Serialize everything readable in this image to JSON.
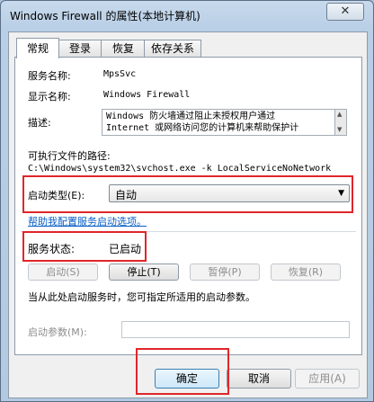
{
  "window": {
    "title": "Windows Firewall 的属性(本地计算机)",
    "close_glyph": "✕"
  },
  "tabs": [
    {
      "label": "常规",
      "active": true
    },
    {
      "label": "登录",
      "active": false
    },
    {
      "label": "恢复",
      "active": false
    },
    {
      "label": "依存关系",
      "active": false
    }
  ],
  "general": {
    "service_name_label": "服务名称:",
    "service_name_value": "MpsSvc",
    "display_name_label": "显示名称:",
    "display_name_value": "Windows Firewall",
    "description_label": "描述:",
    "description_value": "Windows 防火墙通过阻止未授权用户通过\nInternet 或网络访问您的计算机来帮助保护计",
    "exe_path_label": "可执行文件的路径:",
    "exe_path_value": "C:\\Windows\\system32\\svchost.exe -k LocalServiceNoNetwork",
    "startup_type_label": "启动类型(E):",
    "startup_type_value": "自动",
    "help_link": "帮助我配置服务启动选项。",
    "status_label": "服务状态:",
    "status_value": "已启动",
    "btn_start": "启动(S)",
    "btn_stop": "停止(T)",
    "btn_pause": "暂停(P)",
    "btn_resume": "恢复(R)",
    "hint": "当从此处启动服务时，您可指定所适用的启动参数。",
    "start_params_label": "启动参数(M):",
    "start_params_value": ""
  },
  "footer": {
    "ok": "确定",
    "cancel": "取消",
    "apply": "应用(A)"
  },
  "colors": {
    "highlight": "#e0262a",
    "link": "#0b5fc7"
  }
}
